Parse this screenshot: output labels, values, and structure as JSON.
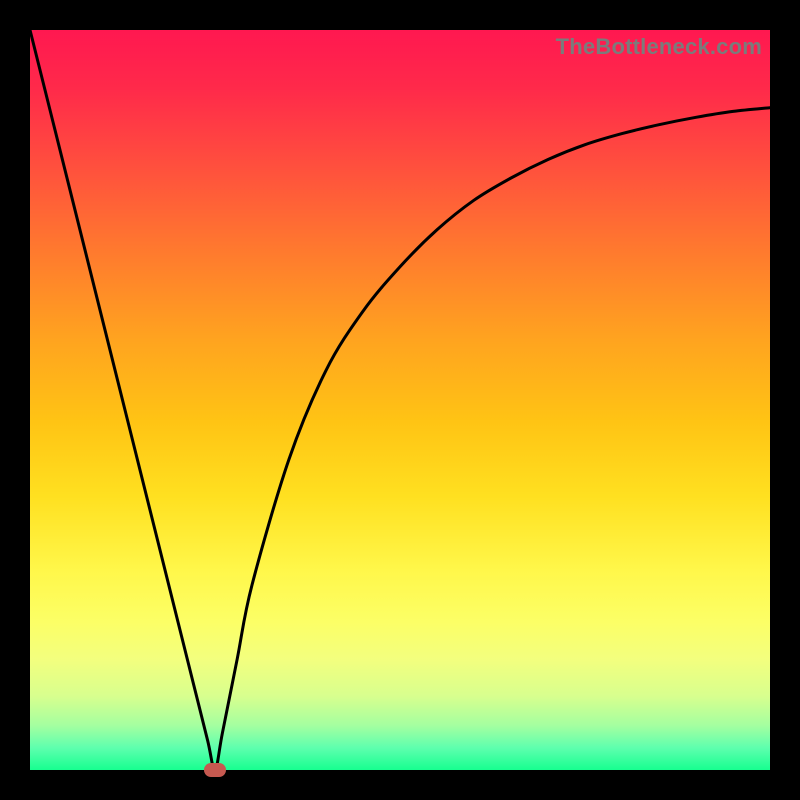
{
  "watermark": "TheBottleneck.com",
  "chart_data": {
    "type": "line",
    "title": "",
    "xlabel": "",
    "ylabel": "",
    "xlim": [
      0,
      100
    ],
    "ylim": [
      0,
      100
    ],
    "grid": false,
    "series": [
      {
        "name": "curve",
        "x": [
          0,
          5,
          10,
          15,
          20,
          22,
          24,
          25,
          26,
          28,
          30,
          35,
          40,
          45,
          50,
          55,
          60,
          65,
          70,
          75,
          80,
          85,
          90,
          95,
          100
        ],
        "values": [
          100,
          80,
          60,
          40,
          20,
          12,
          4,
          0,
          5,
          15,
          25,
          42,
          54,
          62,
          68,
          73,
          77,
          80,
          82.5,
          84.5,
          86,
          87.2,
          88.2,
          89,
          89.5
        ]
      }
    ],
    "marker": {
      "x": 25,
      "y": 0,
      "color": "#c65950"
    },
    "background_gradient": {
      "top": "#ff1850",
      "bottom": "#17ff90"
    }
  }
}
